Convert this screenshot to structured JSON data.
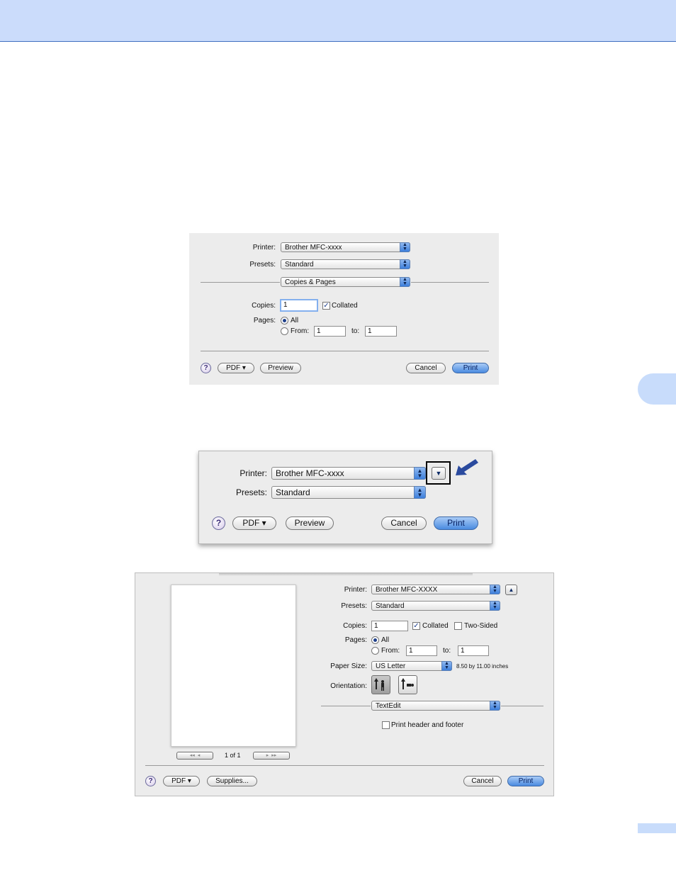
{
  "colors": {
    "header_band": "#cbdcfb",
    "header_rule": "#3f6fc0",
    "tab": "#c8dcfb",
    "accent_blue": "#4a8be0",
    "arrow": "#2a4a9e"
  },
  "dialog1": {
    "printer_label": "Printer:",
    "printer_value": "Brother MFC-xxxx",
    "presets_label": "Presets:",
    "presets_value": "Standard",
    "panel_value": "Copies & Pages",
    "copies_label": "Copies:",
    "copies_value": "1",
    "collated_label": "Collated",
    "collated_checked": true,
    "pages_label": "Pages:",
    "all_label": "All",
    "from_label": "From:",
    "from_value": "1",
    "to_label": "to:",
    "to_value": "1",
    "help_glyph": "?",
    "pdf_label": "PDF ▾",
    "preview_label": "Preview",
    "cancel_label": "Cancel",
    "print_label": "Print"
  },
  "dialog2": {
    "printer_label": "Printer:",
    "printer_value": "Brother MFC-xxxx",
    "presets_label": "Presets:",
    "presets_value": "Standard",
    "disclosure_glyph": "▼",
    "help_glyph": "?",
    "pdf_label": "PDF ▾",
    "preview_label": "Preview",
    "cancel_label": "Cancel",
    "print_label": "Print"
  },
  "dialog3": {
    "printer_label": "Printer:",
    "printer_value": "Brother MFC-XXXX",
    "collapse_glyph": "▲",
    "presets_label": "Presets:",
    "presets_value": "Standard",
    "copies_label": "Copies:",
    "copies_value": "1",
    "collated_label": "Collated",
    "collated_checked": true,
    "two_sided_label": "Two-Sided",
    "two_sided_checked": false,
    "pages_label": "Pages:",
    "all_label": "All",
    "from_label": "From:",
    "from_value": "1",
    "to_label": "to:",
    "to_value": "1",
    "paper_size_label": "Paper Size:",
    "paper_size_value": "US Letter",
    "paper_size_note": "8.50 by 11.00 inches",
    "orientation_label": "Orientation:",
    "panel_value": "TextEdit",
    "header_footer_label": "Print header and footer",
    "header_footer_checked": false,
    "page_indicator": "1 of 1",
    "first_glyph": "◂◂",
    "prev_glyph": "◂",
    "next_glyph": "▸",
    "last_glyph": "▸▸",
    "help_glyph": "?",
    "pdf_label": "PDF ▾",
    "supplies_label": "Supplies...",
    "cancel_label": "Cancel",
    "print_label": "Print"
  }
}
